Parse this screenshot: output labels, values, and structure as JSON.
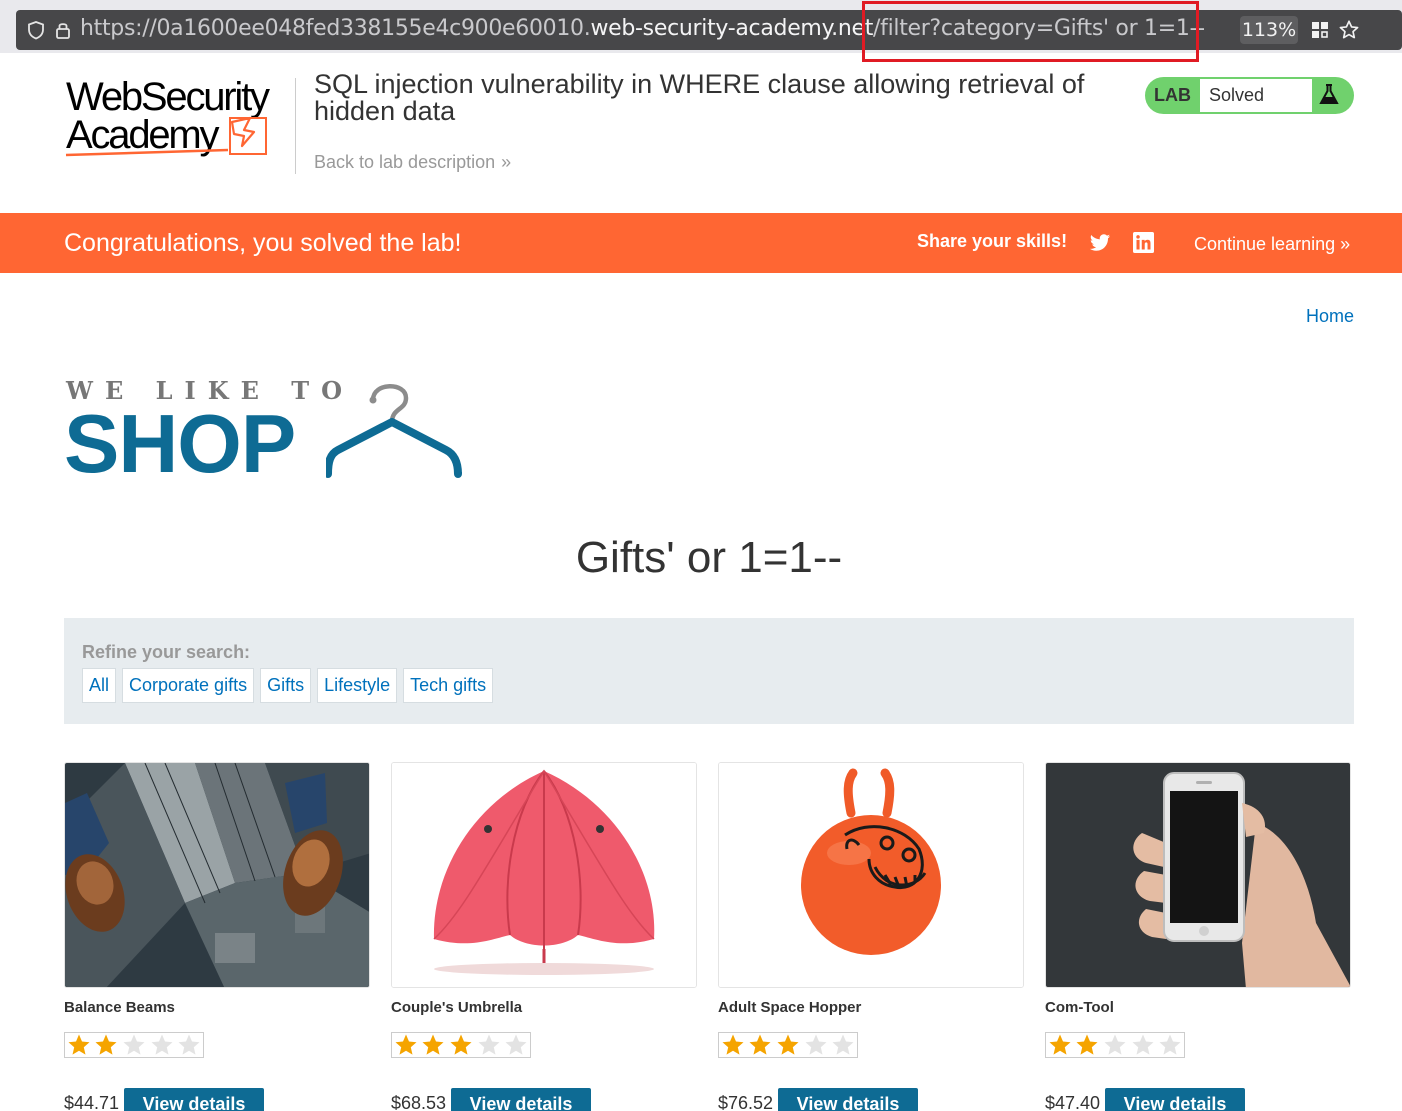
{
  "browser": {
    "url_prefix": "https://0a1600ee048fed338155e4c900e60010.",
    "url_host": "web-security-academy.net",
    "url_path": "/filter?category=Gifts' or 1=1--",
    "zoom": "113%"
  },
  "academy": {
    "logo_line1": "WebSecurity",
    "logo_line2": "Academy",
    "lab_title": "SQL injection vulnerability in WHERE clause allowing retrieval of hidden data",
    "back_link": "Back to lab description",
    "badge_label": "LAB",
    "badge_status": "Solved"
  },
  "banner": {
    "message": "Congratulations, you solved the lab!",
    "share": "Share your skills!",
    "continue": "Continue learning"
  },
  "shop": {
    "home_link": "Home",
    "logo_tagline": "WE LIKE TO",
    "logo_word": "SHOP",
    "heading": "Gifts' or 1=1--",
    "refine_label": "Refine your search:",
    "filters": [
      "All",
      "Corporate gifts",
      "Gifts",
      "Lifestyle",
      "Tech gifts"
    ]
  },
  "products": [
    {
      "name": "Balance Beams",
      "rating": 2,
      "price": "$44.71",
      "button": "View details"
    },
    {
      "name": "Couple's Umbrella",
      "rating": 3,
      "price": "$68.53",
      "button": "View details"
    },
    {
      "name": "Adult Space Hopper",
      "rating": 3,
      "price": "$76.52",
      "button": "View details"
    },
    {
      "name": "Com-Tool",
      "rating": 2,
      "price": "$47.40",
      "button": "View details"
    }
  ],
  "colors": {
    "banner": "#ff6633",
    "brand_blue": "#0e6b94",
    "link": "#0071bc",
    "solved_green": "#70d16d",
    "star_filled": "#f5a400",
    "url_highlight": "#e01b24"
  }
}
